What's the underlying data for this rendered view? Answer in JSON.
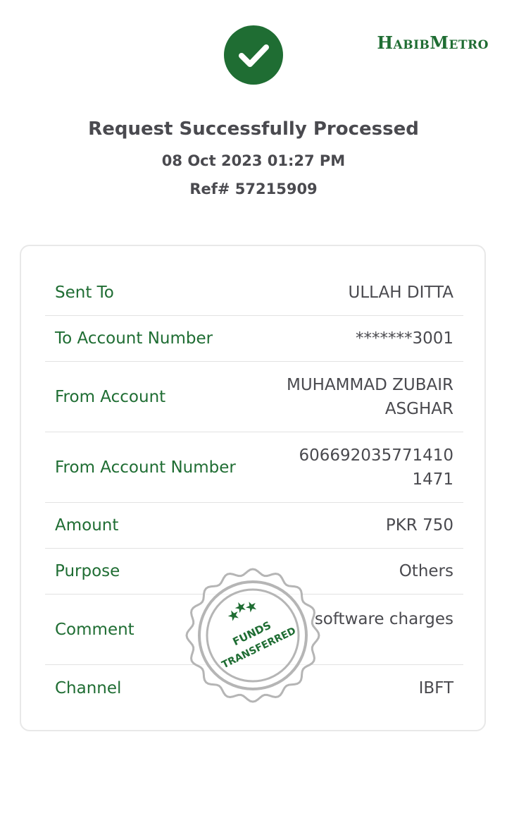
{
  "header": {
    "logo_text": "HabibMetro",
    "success_icon": "check-icon",
    "title": "Request Successfully Processed",
    "datetime": "08 Oct 2023 01:27 PM",
    "ref": "Ref# 57215909"
  },
  "details": [
    {
      "label": "Sent To",
      "value": "ULLAH DITTA"
    },
    {
      "label": "To Account Number",
      "value": "*******3001"
    },
    {
      "label": "From Account",
      "value": "MUHAMMAD ZUBAIR ASGHAR"
    },
    {
      "label": "From Account Number",
      "value": "6066920357714101471"
    },
    {
      "label": "Amount",
      "value": "PKR 750"
    },
    {
      "label": "Purpose",
      "value": "Others"
    },
    {
      "label": "Comment",
      "value": "software charges"
    },
    {
      "label": "Channel",
      "value": "IBFT"
    }
  ],
  "stamp": {
    "line1": "FUNDS",
    "line2": "TRANSFERRED"
  },
  "colors": {
    "brand_green": "#1f6d33",
    "text_gray": "#4a4a4f",
    "stamp_gray": "#b5b5b5"
  }
}
